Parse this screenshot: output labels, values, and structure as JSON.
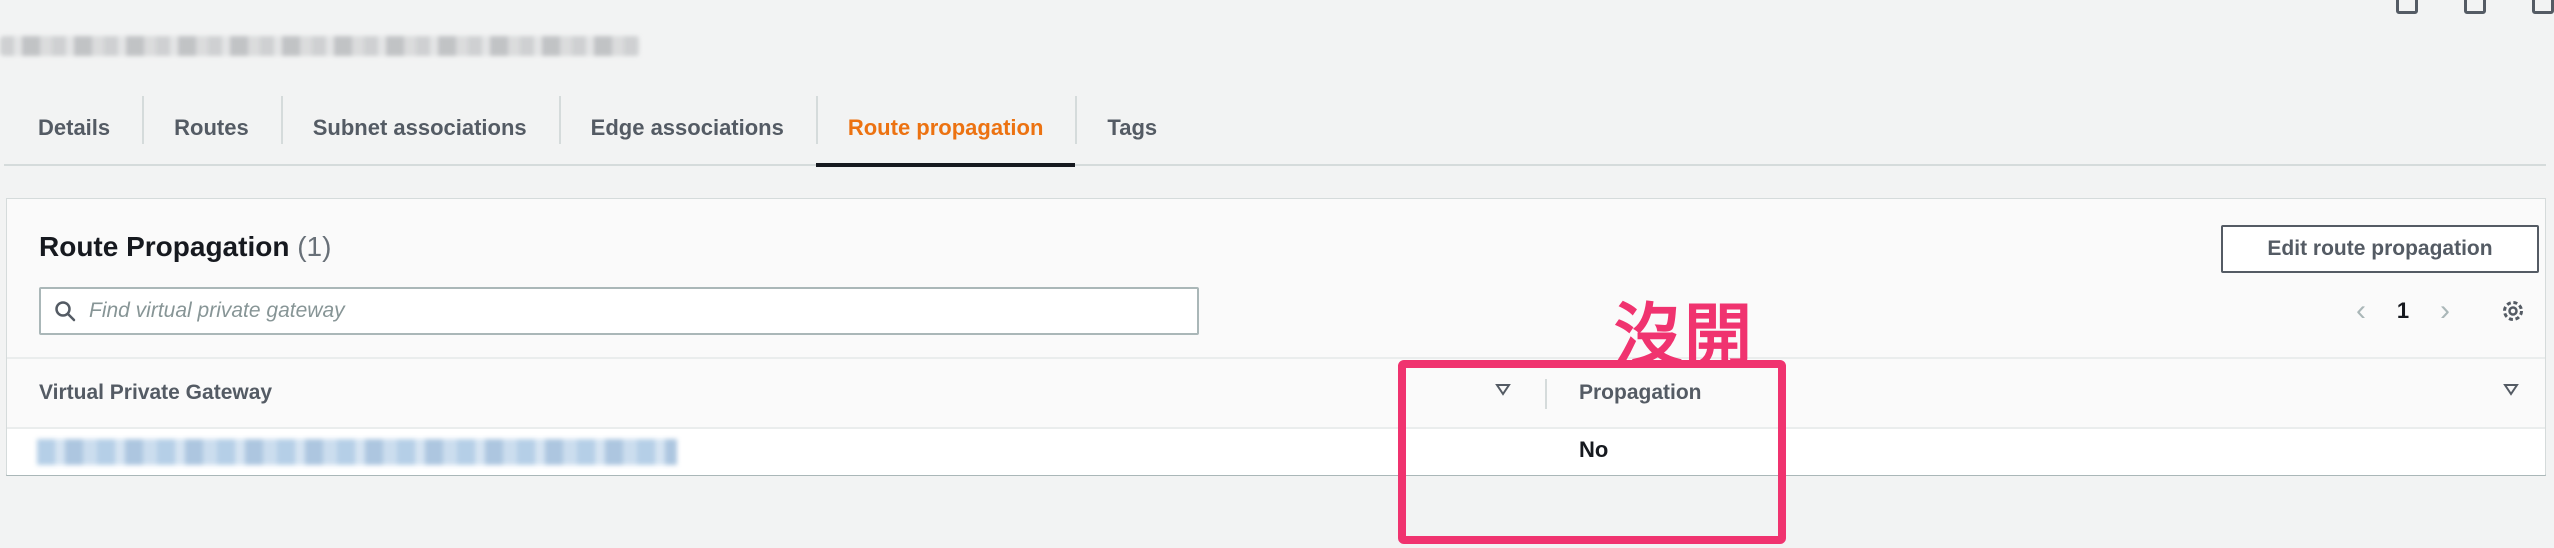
{
  "tabs": [
    {
      "label": "Details"
    },
    {
      "label": "Routes"
    },
    {
      "label": "Subnet associations"
    },
    {
      "label": "Edge associations"
    },
    {
      "label": "Route propagation",
      "active": true
    },
    {
      "label": "Tags"
    }
  ],
  "panel": {
    "title": "Route Propagation",
    "count": "(1)",
    "edit_button": "Edit route propagation",
    "search_placeholder": "Find virtual private gateway",
    "page_number": "1"
  },
  "table": {
    "columns": [
      "Virtual Private Gateway",
      "Propagation"
    ],
    "rows": [
      {
        "propagation": "No"
      }
    ]
  },
  "annotation": {
    "text": "沒開"
  },
  "colors": {
    "accent": "#ec7211",
    "annotation": "#f0336f"
  },
  "icons": [
    "search-icon",
    "chevron-left-icon",
    "chevron-right-icon",
    "gear-icon",
    "sort-down-icon"
  ]
}
